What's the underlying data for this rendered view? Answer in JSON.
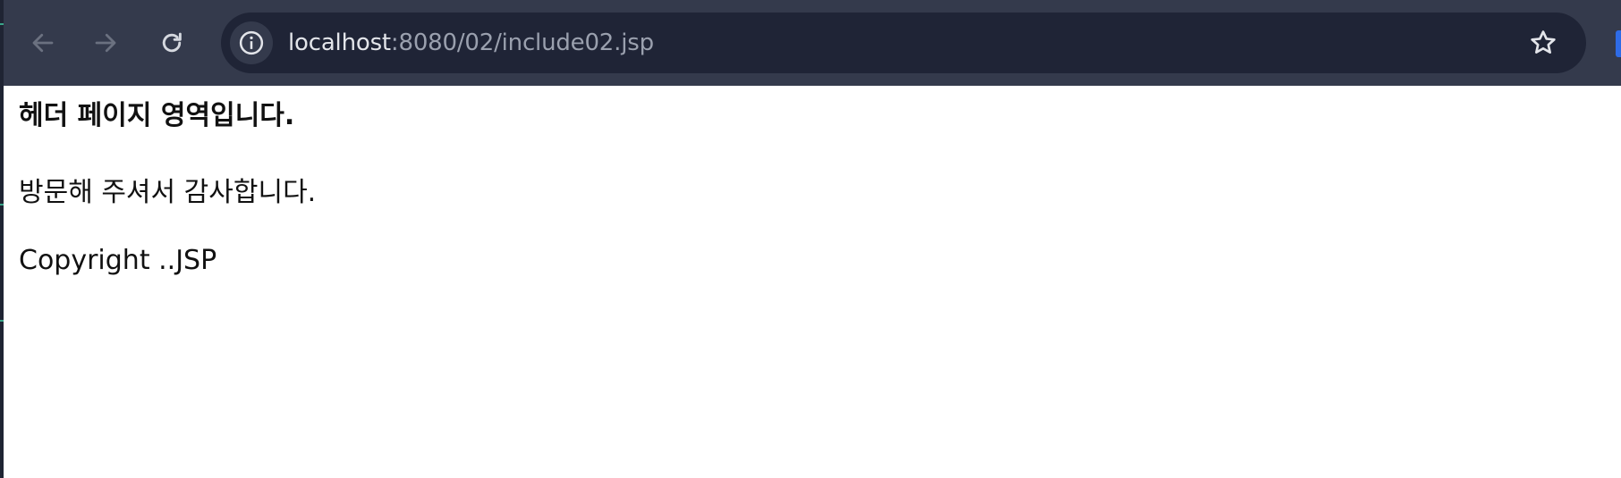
{
  "browser": {
    "url_host": "localhost",
    "url_path": ":8080/02/include02.jsp",
    "icons": {
      "back": "arrow-left-icon",
      "forward": "arrow-right-icon",
      "reload": "reload-icon",
      "info": "info-icon",
      "bookmark": "star-icon"
    }
  },
  "page": {
    "heading": "헤더 페이지 영역입니다.",
    "message": "방문해 주셔서 감사합니다.",
    "footer": "Copyright ..JSP"
  },
  "colors": {
    "toolbar": "#343a4c",
    "omnibox": "#1f2436",
    "accent": "#2e6be6"
  }
}
